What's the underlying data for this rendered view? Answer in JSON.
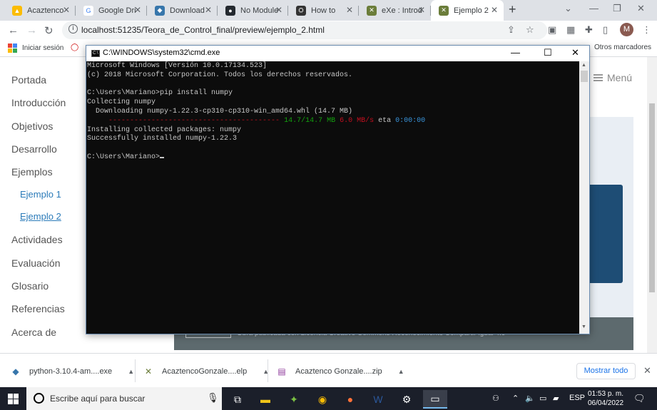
{
  "browser": {
    "tabs": [
      {
        "title": "Acaztenco",
        "fav_color": "#fbbc04",
        "fav_glyph": "▲"
      },
      {
        "title": "Google Dri",
        "fav_color": "#ffffff",
        "fav_glyph": "G"
      },
      {
        "title": "Download",
        "fav_color": "#3776ab",
        "fav_glyph": "◆"
      },
      {
        "title": "No Module",
        "fav_color": "#24292f",
        "fav_glyph": "●"
      },
      {
        "title": "How to",
        "fav_color": "#333333",
        "fav_glyph": "⛭"
      },
      {
        "title": "eXe : Introd",
        "fav_color": "#6b7d3a",
        "fav_glyph": "✕"
      },
      {
        "title": "Ejemplo 2",
        "fav_color": "#6b7d3a",
        "fav_glyph": "✕",
        "active": true
      }
    ],
    "new_tab": "+",
    "url": "localhost:51235/Teora_de_Control_final/preview/ejemplo_2.html",
    "profile_initial": "M",
    "bookmarks": {
      "apps_label": "",
      "signin": "Iniciar sesión",
      "others": "Otros marcadores"
    }
  },
  "page": {
    "menu_label": "Menú",
    "nav": [
      {
        "label": "Portada"
      },
      {
        "label": "Introducción"
      },
      {
        "label": "Objetivos"
      },
      {
        "label": "Desarrollo"
      },
      {
        "label": "Ejemplos"
      },
      {
        "label": "Ejemplo 1",
        "sub": true
      },
      {
        "label": "Ejemplo 2",
        "sub": true,
        "current": true
      },
      {
        "label": "Actividades"
      },
      {
        "label": "Evaluación"
      },
      {
        "label": "Glosario"
      },
      {
        "label": "Referencias"
      },
      {
        "label": "Acerca de"
      }
    ],
    "footer_text": "Obra publicada con Licencia Creative Commons Reconocimiento Compartir igual 4.0"
  },
  "cmd": {
    "title": "C:\\WINDOWS\\system32\\cmd.exe",
    "lines": [
      "Microsoft Windows [Versión 10.0.17134.523]",
      "(c) 2018 Microsoft Corporation. Todos los derechos reservados.",
      "",
      "C:\\Users\\Mariano>pip install numpy",
      "Collecting numpy",
      "  Downloading numpy-1.22.3-cp310-cp310-win_amd64.whl (14.7 MB)",
      "",
      "Installing collected packages: numpy",
      "Successfully installed numpy-1.22.3",
      "",
      "C:\\Users\\Mariano>"
    ],
    "progress": {
      "bar": "----------------------------------------",
      "size": "14.7/14.7 MB",
      "speed": "6.0 MB/s",
      "eta_label": "eta",
      "eta": "0:00:00"
    }
  },
  "downloads": {
    "items": [
      {
        "name": "python-3.10.4-am....exe",
        "icon": "python-icon"
      },
      {
        "name": "AcaztencoGonzale....elp",
        "icon": "exe-icon"
      },
      {
        "name": "Acaztenco Gonzale....zip",
        "icon": "archive-icon"
      }
    ],
    "show_all": "Mostrar todo"
  },
  "taskbar": {
    "search_placeholder": "Escribe aquí para buscar",
    "lang": "ESP",
    "time": "01:53 p. m.",
    "date": "06/04/2022",
    "notif_count": "2"
  }
}
